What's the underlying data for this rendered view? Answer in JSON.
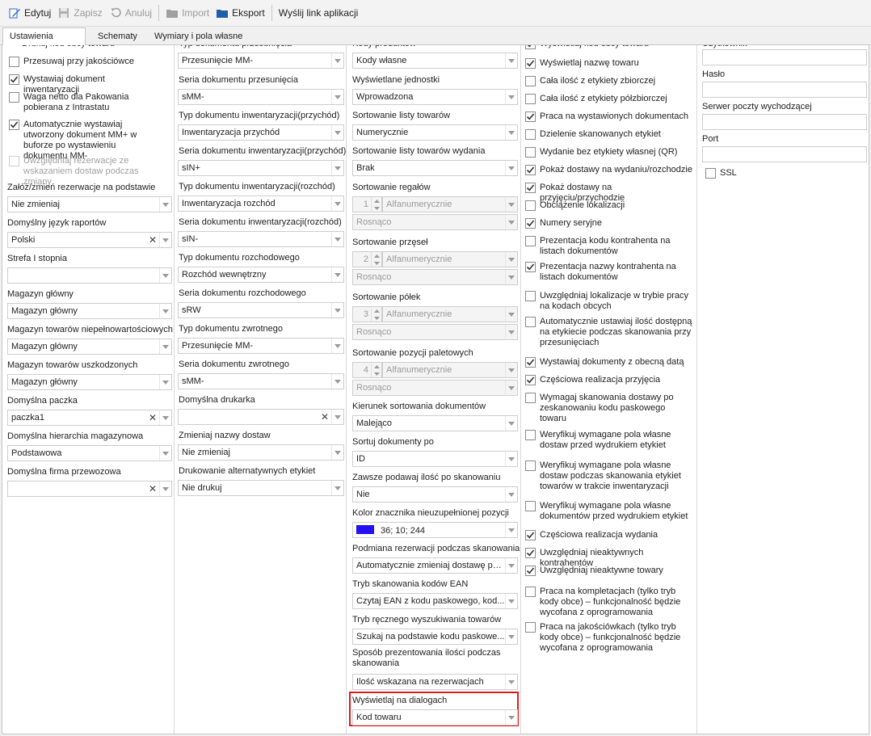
{
  "toolbar": {
    "edit": "Edytuj",
    "save": "Zapisz",
    "undo": "Anuluj",
    "import": "Import",
    "export": "Eksport",
    "share": "Wyślij link aplikacji"
  },
  "tabs": [
    "Ustawienia ogólne",
    "Schematy",
    "Wymiary i pola własne"
  ],
  "col1": {
    "top_label": "Drukuj kod obcy towaru",
    "cb": [
      {
        "t": "Przesuwaj przy jakościówce",
        "c": false
      },
      {
        "t": "Wystawiaj dokument inwentaryzacji",
        "c": true
      },
      {
        "t": "Waga netto dla Pakowania pobierana z Intrastatu",
        "c": false
      },
      {
        "t": "Automatycznie wystawiaj utworzony dokument MM+ w buforze po wystawieniu dokumentu MM-",
        "c": true
      },
      {
        "t": "Uwzględniaj rezerwacje ze wskazaniem dostaw podczas zmiany",
        "c": false
      }
    ],
    "f": [
      {
        "l": "Załóż/zmień rezerwacje na podstawie",
        "v": "Nie zmieniaj"
      },
      {
        "l": "Domyślny język raportów",
        "v": "Polski"
      },
      {
        "l": "Strefa I stopnia",
        "v": ""
      },
      {
        "l": "Magazyn główny",
        "v": "Magazyn główny"
      },
      {
        "l": "Magazyn towarów niepełnowartościowych",
        "v": "Magazyn główny"
      },
      {
        "l": "Magazyn towarów uszkodzonych",
        "v": "Magazyn główny"
      },
      {
        "l": "Domyślna paczka",
        "v": "paczka1"
      },
      {
        "l": "Domyślna hierarchia magazynowa",
        "v": "Podstawowa"
      },
      {
        "l": "Domyślna firma przewozowa",
        "v": ""
      }
    ]
  },
  "col2": {
    "top_label": "Typ dokumentu przesunięcia",
    "top_value": "Przesunięcie MM-",
    "f": [
      {
        "l": "Seria dokumentu przesunięcia",
        "v": "sMM-"
      },
      {
        "l": "Typ dokumentu inwentaryzacji(przychód)",
        "v": "Inwentaryzacja przychód"
      },
      {
        "l": "Seria dokumentu inwentaryzacji(przychód)",
        "v": "sIN+"
      },
      {
        "l": "Typ dokumentu inwentaryzacji(rozchód)",
        "v": "Inwentaryzacja rozchód"
      },
      {
        "l": "Seria dokumentu inwentaryzacji(rozchód)",
        "v": "sIN-"
      },
      {
        "l": "Typ dokumentu rozchodowego",
        "v": "Rozchód wewnętrzny"
      },
      {
        "l": "Seria dokumentu rozchodowego",
        "v": "sRW"
      },
      {
        "l": "Typ dokumentu zwrotnego",
        "v": "Przesunięcie MM-"
      },
      {
        "l": "Seria dokumentu zwrotnego",
        "v": "sMM-"
      },
      {
        "l": "Domyślna drukarka",
        "v": ""
      },
      {
        "l": "Zmieniaj nazwy dostaw",
        "v": "Nie zmieniaj"
      },
      {
        "l": "Drukowanie alternatywnych etykiet",
        "v": "Nie drukuj"
      }
    ]
  },
  "col3": {
    "top_label": "Kody produktów",
    "top_value": "Kody własne",
    "f1": [
      {
        "l": "Wyświetlane jednostki",
        "v": "Wprowadzona"
      },
      {
        "l": "Sortowanie listy towarów",
        "v": "Numerycznie"
      },
      {
        "l": "Sortowanie listy towarów wydania",
        "v": "Brak"
      }
    ],
    "sorts": [
      {
        "l": "Sortowanie regałów",
        "n": "1",
        "a": "Alfanumerycznie",
        "o": "Rosnąco"
      },
      {
        "l": "Sortowanie przęseł",
        "n": "2",
        "a": "Alfanumerycznie",
        "o": "Rosnąco"
      },
      {
        "l": "Sortowanie półek",
        "n": "3",
        "a": "Alfanumerycznie",
        "o": "Rosnąco"
      },
      {
        "l": "Sortowanie pozycji paletowych",
        "n": "4",
        "a": "Alfanumerycznie",
        "o": "Rosnąco"
      }
    ],
    "f2": [
      {
        "l": "Kierunek sortowania dokumentów",
        "v": "Malejąco"
      },
      {
        "l": "Sortuj dokumenty po",
        "v": "ID"
      },
      {
        "l": "Zawsze podawaj ilość po skanowaniu",
        "v": "Nie"
      }
    ],
    "color_label": "Kolor znacznika nieuzupełnionej pozycji",
    "color_value": "36; 10; 244",
    "color_hex": "#2411f4",
    "f3": [
      {
        "l": "Podmiana rezerwacji podczas skanowania",
        "v": "Automatycznie zmieniaj dostawę po..."
      },
      {
        "l": "Tryb skanowania kodów EAN",
        "v": "Czytaj EAN z kodu paskowego, kod..."
      },
      {
        "l": "Tryb ręcznego wyszukiwania towarów",
        "v": "Szukaj na podstawie kodu paskowe..."
      }
    ],
    "qty_label": "Sposób prezentowania ilości podczas skanowania",
    "qty_value": "Ilość wskazana na rezerwacjach",
    "dlg_label": "Wyświetlaj na dialogach",
    "dlg_value": "Kod towaru"
  },
  "col4": {
    "top_label": "Wyświetlaj kod obcy towaru",
    "cb": [
      {
        "t": "Wyświetlaj nazwę towaru",
        "c": true
      },
      {
        "t": "Cała ilość z etykiety zbiorczej",
        "c": false
      },
      {
        "t": "Cała ilość z etykiety półzbiorczej",
        "c": false
      },
      {
        "t": "Praca na wystawionych dokumentach",
        "c": true
      },
      {
        "t": "Dzielenie skanowanych etykiet",
        "c": false
      },
      {
        "t": "Wydanie bez etykiety własnej (QR)",
        "c": false
      },
      {
        "t": "Pokaż dostawy na wydaniu/rozchodzie",
        "c": true
      },
      {
        "t": "Pokaż dostawy na przyjęciu/przychodzie",
        "c": true
      },
      {
        "t": "Obciążenie lokalizacji",
        "c": false
      },
      {
        "t": "Numery seryjne",
        "c": true
      },
      {
        "t": "Prezentacja kodu kontrahenta na listach dokumentów",
        "c": false
      },
      {
        "t": "Prezentacja nazwy kontrahenta na listach dokumentów",
        "c": true
      },
      {
        "t": "Uwzględniaj lokalizacje w trybie pracy na kodach obcych",
        "c": false
      },
      {
        "t": "Automatycznie ustawiaj ilość dostępną na etykiecie podczas skanowania przy przesunięciach",
        "c": false
      },
      {
        "t": "Wystawiaj dokumenty z obecną datą",
        "c": true
      },
      {
        "t": "Częściowa realizacja przyjęcia",
        "c": true
      },
      {
        "t": "Wymagaj skanowania dostawy po zeskanowaniu kodu paskowego towaru",
        "c": false
      },
      {
        "t": "Weryfikuj wymagane pola własne dostaw przed wydrukiem etykiet",
        "c": false
      },
      {
        "t": "Weryfikuj wymagane pola własne dostaw podczas skanowania etykiet towarów w trakcie inwentaryzacji",
        "c": false
      },
      {
        "t": "Weryfikuj wymagane pola własne dokumentów przed wydrukiem etykiet",
        "c": false
      },
      {
        "t": "Częściowa realizacja wydania",
        "c": true
      },
      {
        "t": "Uwzględniaj nieaktywnych kontrahentów",
        "c": true
      },
      {
        "t": "Uwzględniaj nieaktywne towary",
        "c": true
      },
      {
        "t": "Praca na kompletacjach (tylko tryb kody obce) – funkcjonalność będzie wycofana z oprogramowania",
        "c": false
      },
      {
        "t": "Praca na jakościówkach (tylko tryb kody obce) – funkcjonalność będzie wycofana z oprogramowania",
        "c": false
      }
    ]
  },
  "col5": {
    "top_label": "Użytkownik",
    "password_label": "Hasło",
    "smtp_label": "Serwer poczty wychodzącej",
    "port_label": "Port",
    "ssl_label": "SSL"
  }
}
